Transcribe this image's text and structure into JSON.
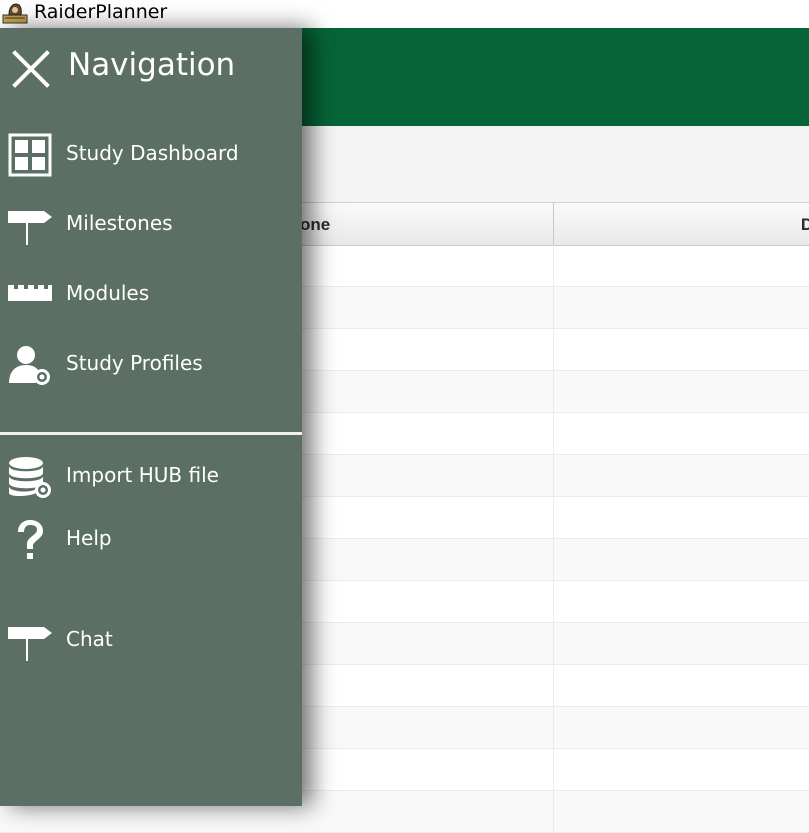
{
  "window": {
    "title": "RaiderPlanner"
  },
  "nav": {
    "title": "Navigation",
    "items": [
      {
        "label": "Study Dashboard",
        "icon": "dashboard-icon"
      },
      {
        "label": "Milestones",
        "icon": "signpost-icon"
      },
      {
        "label": "Modules",
        "icon": "modules-icon"
      },
      {
        "label": "Study Profiles",
        "icon": "user-settings-icon"
      },
      {
        "label": "Import HUB file",
        "icon": "database-settings-icon"
      },
      {
        "label": "Help",
        "icon": "question-icon"
      },
      {
        "label": "Chat",
        "icon": "signpost-icon"
      }
    ]
  },
  "table": {
    "columns": [
      "one",
      "Dea"
    ]
  },
  "colors": {
    "header": "#066538",
    "drawer": "#5b6f65"
  }
}
